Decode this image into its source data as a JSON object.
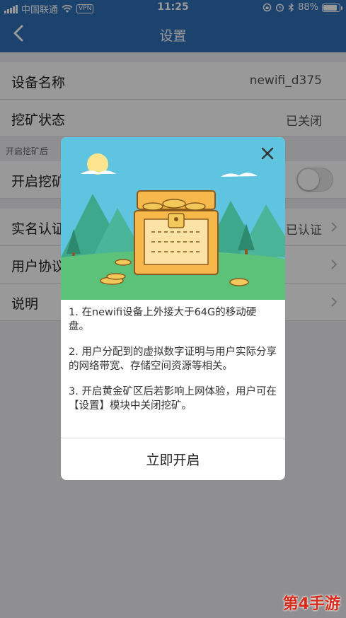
{
  "status_bar": {
    "carrier": "中国联通",
    "vpn": "VPN",
    "time": "11:25",
    "battery": "88%",
    "battery_level": 0.88
  },
  "nav": {
    "title": "设置"
  },
  "settings": {
    "device_name_label": "设备名称",
    "device_name_value": "newifi_d375",
    "mining_status_label": "挖矿状态",
    "mining_status_value": "已关闭",
    "hint": "开启挖矿后",
    "enable_mining_label": "开启挖矿",
    "realname_label": "实名认证",
    "realname_value": "已认证",
    "agreement_label": "用户协议",
    "description_label": "说明"
  },
  "modal": {
    "points": [
      "1. 在newifi设备上外接大于64G的移动硬盘。",
      "2. 用户分配到的虚拟数字证明与用户实际分享的网络带宽、存储空间资源等相关。",
      "3. 开启黄金矿区后若影响上网体验，用户可在【设置】模块中关闭挖矿。"
    ],
    "button": "立即开启"
  },
  "watermark": "第4手游"
}
